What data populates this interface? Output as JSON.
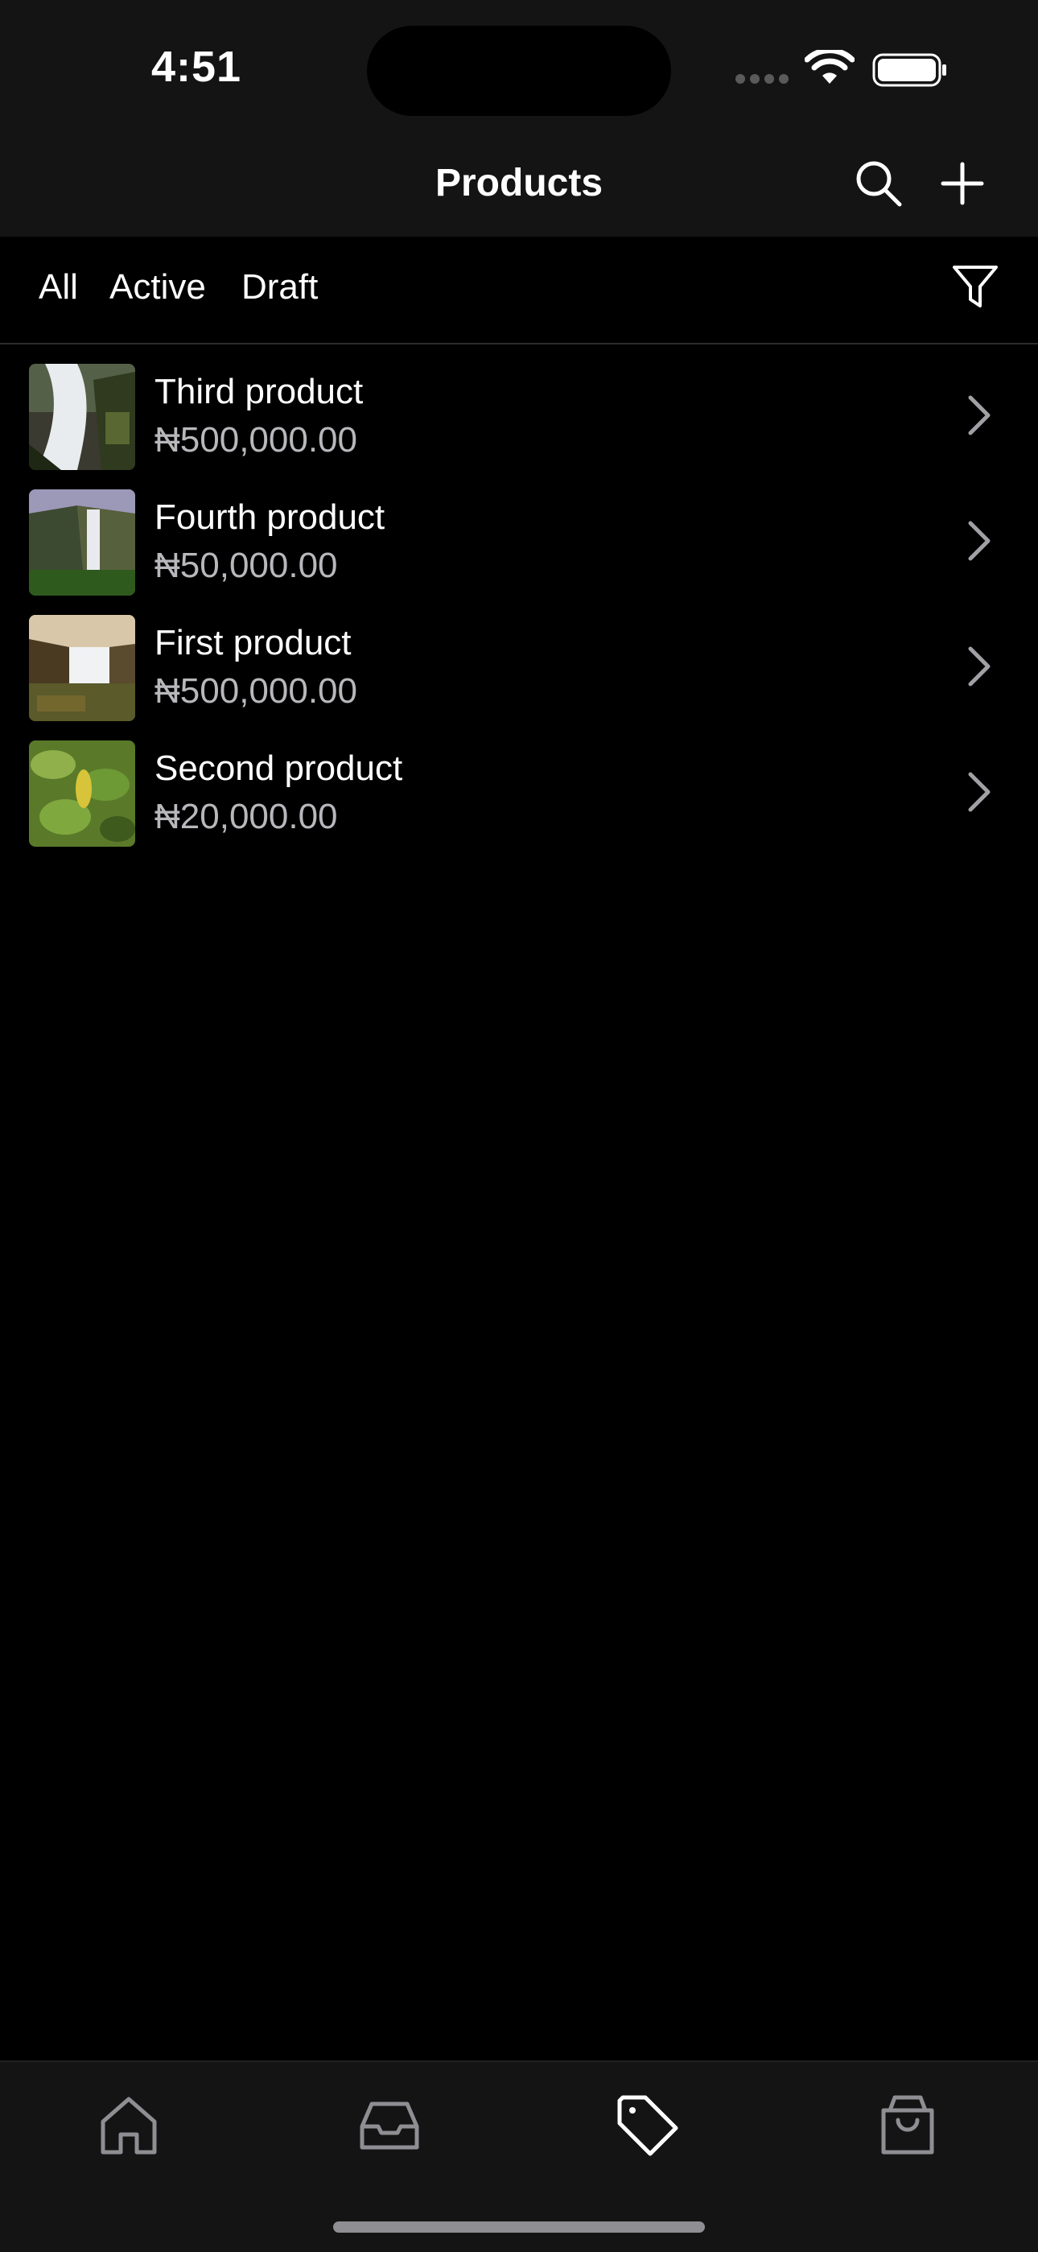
{
  "status_bar": {
    "time": "4:51"
  },
  "nav": {
    "title": "Products"
  },
  "filters": {
    "segments": [
      "All",
      "Active",
      "Draft"
    ]
  },
  "products": [
    {
      "name": "Third product",
      "price": "₦500,000.00",
      "thumbnail": "waterfall-rocks"
    },
    {
      "name": "Fourth product",
      "price": "₦50,000.00",
      "thumbnail": "waterfall-cliff"
    },
    {
      "name": "First product",
      "price": "₦500,000.00",
      "thumbnail": "waterfall-sunset"
    },
    {
      "name": "Second product",
      "price": "₦20,000.00",
      "thumbnail": "green-leaves"
    }
  ],
  "tab_bar": {
    "items": [
      {
        "icon": "home-icon",
        "selected": false
      },
      {
        "icon": "inbox-icon",
        "selected": false
      },
      {
        "icon": "tag-icon",
        "selected": true
      },
      {
        "icon": "shopping-bag-icon",
        "selected": false
      }
    ]
  },
  "colors": {
    "background": "#000000",
    "bar_background": "#141414",
    "price_text": "#b8b8bc",
    "inactive_icon": "#8e8e93"
  }
}
